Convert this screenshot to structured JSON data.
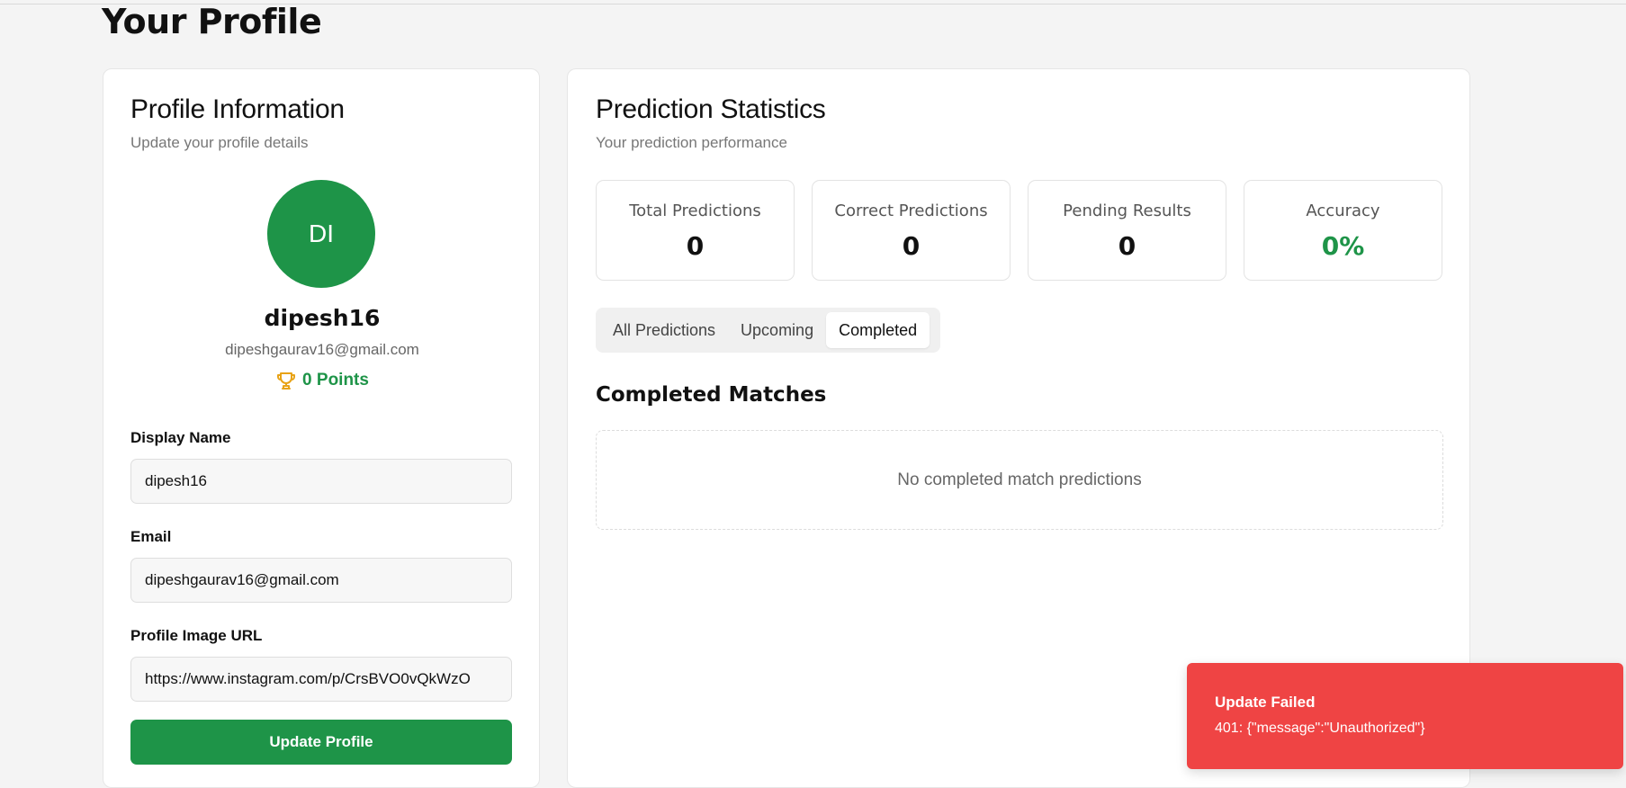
{
  "page": {
    "title": "Your Profile"
  },
  "profile_card": {
    "title": "Profile Information",
    "subtitle": "Update your profile details",
    "avatar_initials": "DI",
    "username": "dipesh16",
    "email": "dipeshgaurav16@gmail.com",
    "points": "0 Points",
    "fields": {
      "display_name": {
        "label": "Display Name",
        "value": "dipesh16"
      },
      "email": {
        "label": "Email",
        "value": "dipeshgaurav16@gmail.com"
      },
      "profile_image_url": {
        "label": "Profile Image URL",
        "value": "https://www.instagram.com/p/CrsBVO0vQkWzO"
      }
    },
    "update_button": "Update Profile"
  },
  "stats_card": {
    "title": "Prediction Statistics",
    "subtitle": "Your prediction performance",
    "stats": [
      {
        "label": "Total Predictions",
        "value": "0"
      },
      {
        "label": "Correct Predictions",
        "value": "0"
      },
      {
        "label": "Pending Results",
        "value": "0"
      },
      {
        "label": "Accuracy",
        "value": "0%"
      }
    ],
    "tabs": [
      {
        "label": "All Predictions",
        "active": false
      },
      {
        "label": "Upcoming",
        "active": false
      },
      {
        "label": "Completed",
        "active": true
      }
    ],
    "section_title": "Completed Matches",
    "empty_message": "No completed match predictions"
  },
  "toast": {
    "title": "Update Failed",
    "message": "401: {\"message\":\"Unauthorized\"}"
  },
  "colors": {
    "brand_green": "#1e9448",
    "error_red": "#ef4444",
    "trophy_gold": "#e8a317"
  },
  "icons": {
    "points": "trophy-icon"
  }
}
